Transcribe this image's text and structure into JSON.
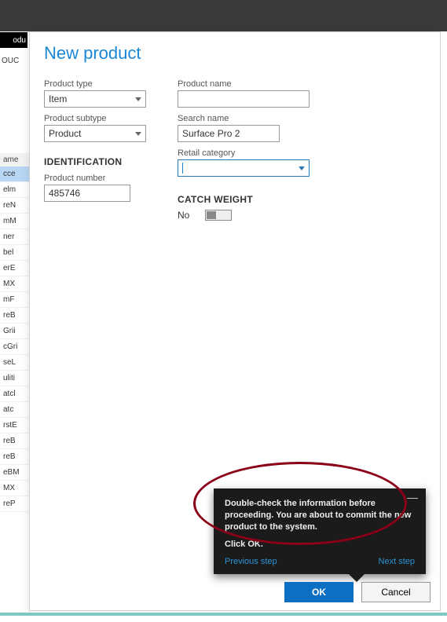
{
  "topbar": {
    "chip": "odu"
  },
  "ouc_label": "OUC",
  "sidebar": {
    "header": "ame",
    "items": [
      "cce",
      "elm",
      "reN",
      "mM",
      "ner",
      "bel",
      "erE",
      "MX",
      "mF",
      "reB",
      "Grii",
      "cGri",
      "seL",
      "uliti",
      "atcl",
      "atc",
      "rstE",
      "reB",
      "reB",
      "eBM",
      "MX",
      "reP"
    ]
  },
  "dialog": {
    "title": "New product",
    "fields": {
      "product_type_label": "Product type",
      "product_type_value": "Item",
      "product_subtype_label": "Product subtype",
      "product_subtype_value": "Product",
      "identification_section": "IDENTIFICATION",
      "product_number_label": "Product number",
      "product_number_value": "485746",
      "product_name_label": "Product name",
      "product_name_value": "",
      "search_name_label": "Search name",
      "search_name_value": "Surface Pro 2",
      "retail_category_label": "Retail category",
      "retail_category_value": "",
      "catch_weight_section": "CATCH WEIGHT",
      "catch_weight_value": "No"
    },
    "buttons": {
      "ok": "OK",
      "cancel": "Cancel"
    }
  },
  "tooltip": {
    "body": "Double-check the information before proceeding. You are about to commit the new product to the system.",
    "ok_line": "Click OK.",
    "prev": "Previous step",
    "next": "Next step"
  }
}
